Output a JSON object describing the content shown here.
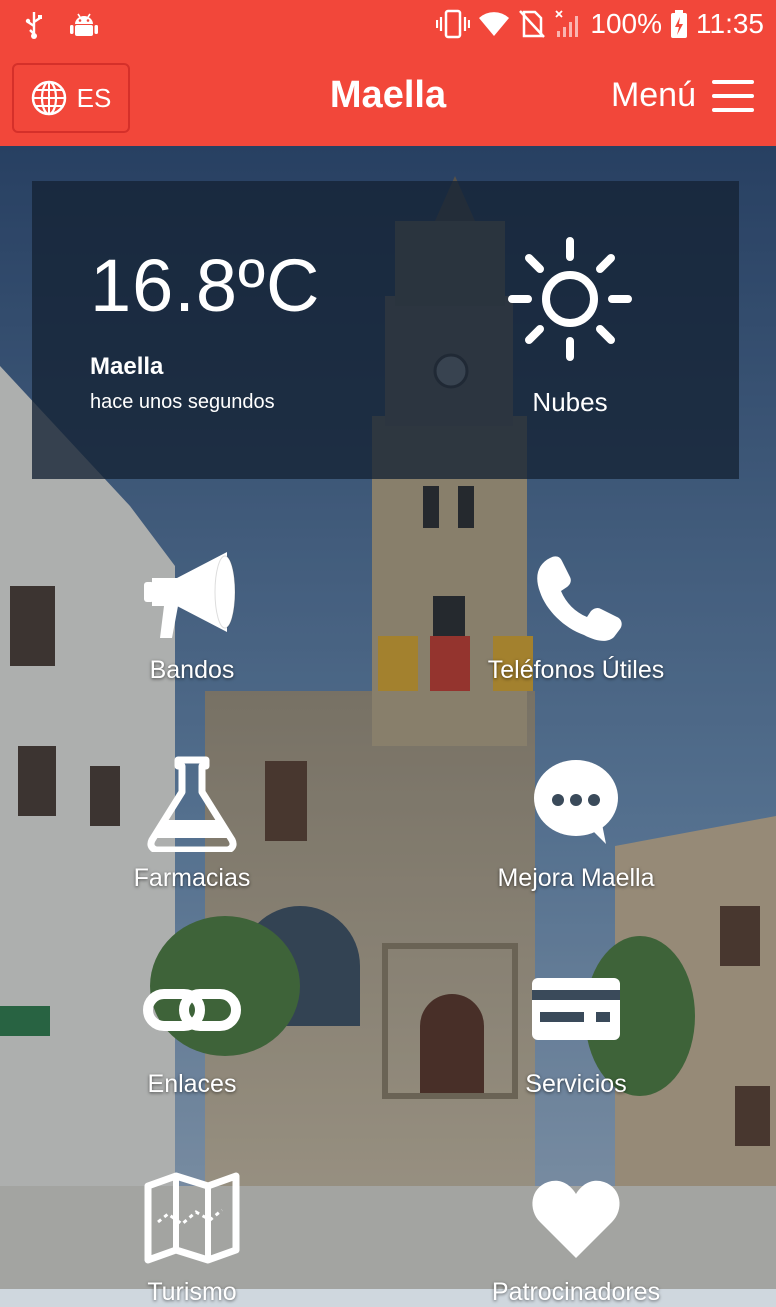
{
  "status_bar": {
    "battery": "100%",
    "time": "11:35"
  },
  "app_bar": {
    "language": "ES",
    "title": "Maella",
    "menu_label": "Menú"
  },
  "weather": {
    "temperature": "16.8ºC",
    "city": "Maella",
    "updated": "hace unos segundos",
    "condition": "Nubes",
    "icon": "sun-icon"
  },
  "tiles": [
    {
      "label": "Bandos",
      "icon": "megaphone-icon"
    },
    {
      "label": "Teléfonos Útiles",
      "icon": "phone-icon"
    },
    {
      "label": "Farmacias",
      "icon": "flask-icon"
    },
    {
      "label": "Mejora Maella",
      "icon": "chat-bubble-icon"
    },
    {
      "label": "Enlaces",
      "icon": "link-icon"
    },
    {
      "label": "Servicios",
      "icon": "credit-card-icon"
    },
    {
      "label": "Turismo",
      "icon": "map-icon"
    },
    {
      "label": "Patrocinadores",
      "icon": "heart-icon"
    }
  ],
  "colors": {
    "accent": "#f2473a",
    "card": "#142234"
  }
}
